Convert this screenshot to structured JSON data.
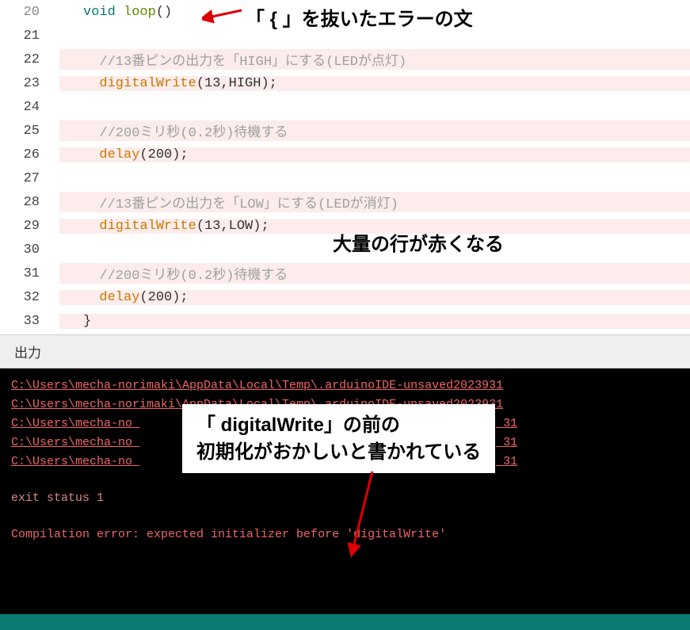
{
  "code": {
    "lines": [
      {
        "n": 20,
        "error": false,
        "tokens": [
          {
            "cls": "kw-void",
            "t": "void"
          },
          {
            "cls": "plain",
            "t": " "
          },
          {
            "cls": "kw-func",
            "t": "loop"
          },
          {
            "cls": "punct",
            "t": "()"
          }
        ]
      },
      {
        "n": 21,
        "error": true,
        "tokens": []
      },
      {
        "n": 22,
        "error": true,
        "tokens": [
          {
            "cls": "comment",
            "t": "  //13番ピンの出力を「HIGH」にする(LEDが点灯)"
          }
        ]
      },
      {
        "n": 23,
        "error": true,
        "tokens": [
          {
            "cls": "plain",
            "t": "  "
          },
          {
            "cls": "call",
            "t": "digitalWrite"
          },
          {
            "cls": "punct",
            "t": "("
          },
          {
            "cls": "num",
            "t": "13"
          },
          {
            "cls": "punct",
            "t": ","
          },
          {
            "cls": "const",
            "t": "HIGH"
          },
          {
            "cls": "punct",
            "t": ");"
          }
        ]
      },
      {
        "n": 24,
        "error": true,
        "tokens": []
      },
      {
        "n": 25,
        "error": true,
        "tokens": [
          {
            "cls": "comment",
            "t": "  //200ミリ秒(0.2秒)待機する"
          }
        ]
      },
      {
        "n": 26,
        "error": true,
        "tokens": [
          {
            "cls": "plain",
            "t": "  "
          },
          {
            "cls": "call",
            "t": "delay"
          },
          {
            "cls": "punct",
            "t": "("
          },
          {
            "cls": "num",
            "t": "200"
          },
          {
            "cls": "punct",
            "t": ");"
          }
        ]
      },
      {
        "n": 27,
        "error": true,
        "tokens": []
      },
      {
        "n": 28,
        "error": true,
        "tokens": [
          {
            "cls": "comment",
            "t": "  //13番ピンの出力を「LOW」にする(LEDが消灯)"
          }
        ]
      },
      {
        "n": 29,
        "error": true,
        "tokens": [
          {
            "cls": "plain",
            "t": "  "
          },
          {
            "cls": "call",
            "t": "digitalWrite"
          },
          {
            "cls": "punct",
            "t": "("
          },
          {
            "cls": "num",
            "t": "13"
          },
          {
            "cls": "punct",
            "t": ","
          },
          {
            "cls": "const",
            "t": "LOW"
          },
          {
            "cls": "punct",
            "t": ");"
          }
        ]
      },
      {
        "n": 30,
        "error": true,
        "tokens": []
      },
      {
        "n": 31,
        "error": true,
        "tokens": [
          {
            "cls": "comment",
            "t": "  //200ミリ秒(0.2秒)待機する"
          }
        ]
      },
      {
        "n": 32,
        "error": true,
        "tokens": [
          {
            "cls": "plain",
            "t": "  "
          },
          {
            "cls": "call",
            "t": "delay"
          },
          {
            "cls": "punct",
            "t": "("
          },
          {
            "cls": "num",
            "t": "200"
          },
          {
            "cls": "punct",
            "t": ");"
          }
        ]
      },
      {
        "n": 33,
        "error": true,
        "tokens": [
          {
            "cls": "punct",
            "t": "}"
          }
        ]
      }
    ]
  },
  "outputTab": "出力",
  "console": {
    "path_full": "C:\\Users\\mecha-norimaki\\AppData\\Local\\Temp\\.arduinoIDE-unsaved2023931",
    "path_trunc": "C:\\Users\\mecha-no",
    "path_trunc2": "C:\\Users\\mecha-no",
    "path_trail": "31",
    "exit": "exit status 1",
    "compilation": "Compilation error: expected initializer before 'digitalWrite'"
  },
  "annotations": {
    "a1": "「 { 」を抜いたエラーの文",
    "a2": "大量の行が赤くなる",
    "box_line1": "「 digitalWrite」の前の",
    "box_line2": "初期化がおかしいと書かれている"
  }
}
